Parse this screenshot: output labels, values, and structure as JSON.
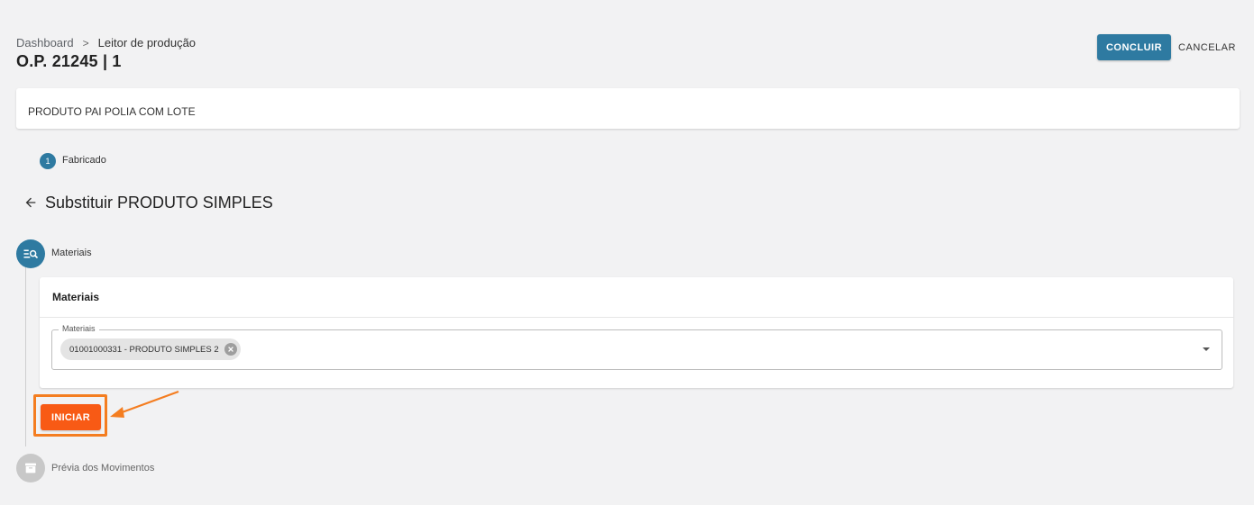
{
  "header": {
    "breadcrumb": {
      "root": "Dashboard",
      "separator": ">",
      "current": "Leitor de produção"
    },
    "title": "O.P. 21245 | 1",
    "actions": {
      "conclude_label": "CONCLUIR",
      "cancel_label": "CANCELAR"
    }
  },
  "product": {
    "name": "PRODUTO PAI POLIA COM LOTE"
  },
  "top_stepper": {
    "step_number": "1",
    "step_label": "Fabricado"
  },
  "section": {
    "title": "Substituir PRODUTO SIMPLES",
    "back_icon": "arrow-left-icon"
  },
  "vertical_stepper": {
    "steps": [
      {
        "label": "Materiais",
        "icon": "list-search-icon",
        "state": "active"
      },
      {
        "label": "Prévia dos Movimentos",
        "icon": "archive-box-icon",
        "state": "inactive"
      }
    ]
  },
  "materials_card": {
    "title": "Materiais",
    "field": {
      "legend": "Materiais",
      "chips": [
        {
          "label": "01001000331 - PRODUTO SIMPLES 2"
        }
      ]
    }
  },
  "start_button": {
    "label": "INICIAR"
  },
  "colors": {
    "primary": "#2e7aa1",
    "start_button": "#f85a15",
    "annotation": "#f47d20",
    "background": "#f2f2f3"
  }
}
